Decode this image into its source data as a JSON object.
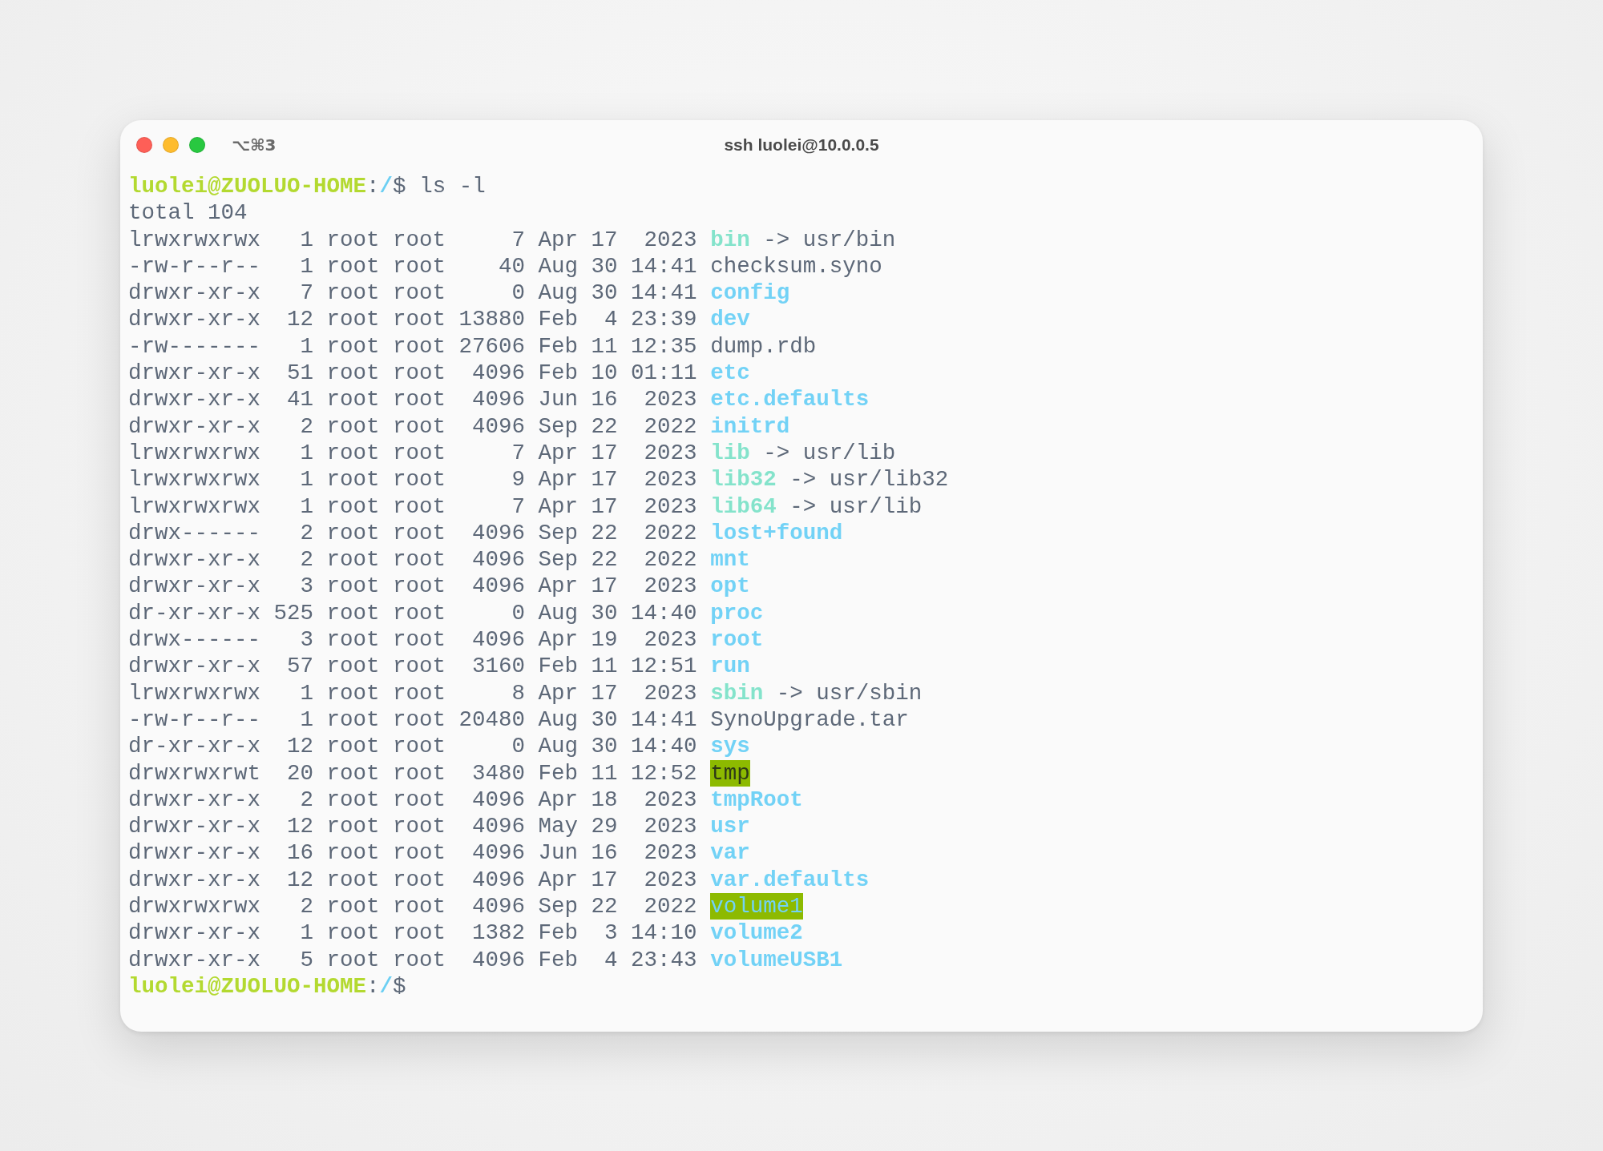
{
  "window": {
    "title": "ssh luolei@10.0.0.5",
    "shortcut": "⌥⌘3"
  },
  "prompt": {
    "user_host": "luolei@ZUOLUO-HOME",
    "separator": ":",
    "path": "/",
    "symbol": "$",
    "command": "ls -l"
  },
  "output_header": "total 104",
  "rows": [
    {
      "info": "lrwxrwxrwx   1 root root     7 Apr 17  2023",
      "name": "bin",
      "kind": "link",
      "target": "-> usr/bin"
    },
    {
      "info": "-rw-r--r--   1 root root    40 Aug 30 14:41",
      "name": "checksum.syno",
      "kind": "file"
    },
    {
      "info": "drwxr-xr-x   7 root root     0 Aug 30 14:41",
      "name": "config",
      "kind": "dir"
    },
    {
      "info": "drwxr-xr-x  12 root root 13880 Feb  4 23:39",
      "name": "dev",
      "kind": "dir"
    },
    {
      "info": "-rw-------   1 root root 27606 Feb 11 12:35",
      "name": "dump.rdb",
      "kind": "file"
    },
    {
      "info": "drwxr-xr-x  51 root root  4096 Feb 10 01:11",
      "name": "etc",
      "kind": "dir"
    },
    {
      "info": "drwxr-xr-x  41 root root  4096 Jun 16  2023",
      "name": "etc.defaults",
      "kind": "dir"
    },
    {
      "info": "drwxr-xr-x   2 root root  4096 Sep 22  2022",
      "name": "initrd",
      "kind": "dir"
    },
    {
      "info": "lrwxrwxrwx   1 root root     7 Apr 17  2023",
      "name": "lib",
      "kind": "link",
      "target": "-> usr/lib"
    },
    {
      "info": "lrwxrwxrwx   1 root root     9 Apr 17  2023",
      "name": "lib32",
      "kind": "link",
      "target": "-> usr/lib32"
    },
    {
      "info": "lrwxrwxrwx   1 root root     7 Apr 17  2023",
      "name": "lib64",
      "kind": "link",
      "target": "-> usr/lib"
    },
    {
      "info": "drwx------   2 root root  4096 Sep 22  2022",
      "name": "lost+found",
      "kind": "dir"
    },
    {
      "info": "drwxr-xr-x   2 root root  4096 Sep 22  2022",
      "name": "mnt",
      "kind": "dir"
    },
    {
      "info": "drwxr-xr-x   3 root root  4096 Apr 17  2023",
      "name": "opt",
      "kind": "dir"
    },
    {
      "info": "dr-xr-xr-x 525 root root     0 Aug 30 14:40",
      "name": "proc",
      "kind": "dir"
    },
    {
      "info": "drwx------   3 root root  4096 Apr 19  2023",
      "name": "root",
      "kind": "dir"
    },
    {
      "info": "drwxr-xr-x  57 root root  3160 Feb 11 12:51",
      "name": "run",
      "kind": "dir"
    },
    {
      "info": "lrwxrwxrwx   1 root root     8 Apr 17  2023",
      "name": "sbin",
      "kind": "link",
      "target": "-> usr/sbin"
    },
    {
      "info": "-rw-r--r--   1 root root 20480 Aug 30 14:41",
      "name": "SynoUpgrade.tar",
      "kind": "file"
    },
    {
      "info": "dr-xr-xr-x  12 root root     0 Aug 30 14:40",
      "name": "sys",
      "kind": "dir"
    },
    {
      "info": "drwxrwxrwt  20 root root  3480 Feb 11 12:52",
      "name": "tmp",
      "kind": "sticky"
    },
    {
      "info": "drwxr-xr-x   2 root root  4096 Apr 18  2023",
      "name": "tmpRoot",
      "kind": "dir"
    },
    {
      "info": "drwxr-xr-x  12 root root  4096 May 29  2023",
      "name": "usr",
      "kind": "dir"
    },
    {
      "info": "drwxr-xr-x  16 root root  4096 Jun 16  2023",
      "name": "var",
      "kind": "dir"
    },
    {
      "info": "drwxr-xr-x  12 root root  4096 Apr 17  2023",
      "name": "var.defaults",
      "kind": "dir"
    },
    {
      "info": "drwxrwxrwx   2 root root  4096 Sep 22  2022",
      "name": "volume1",
      "kind": "writable"
    },
    {
      "info": "drwxr-xr-x   1 root root  1382 Feb  3 14:10",
      "name": "volume2",
      "kind": "dir"
    },
    {
      "info": "drwxr-xr-x   5 root root  4096 Feb  4 23:43",
      "name": "volumeUSB1",
      "kind": "dir"
    }
  ],
  "final_prompt": {
    "user_host": "luolei@ZUOLUO-HOME",
    "separator": ":",
    "path": "/",
    "symbol": "$"
  }
}
